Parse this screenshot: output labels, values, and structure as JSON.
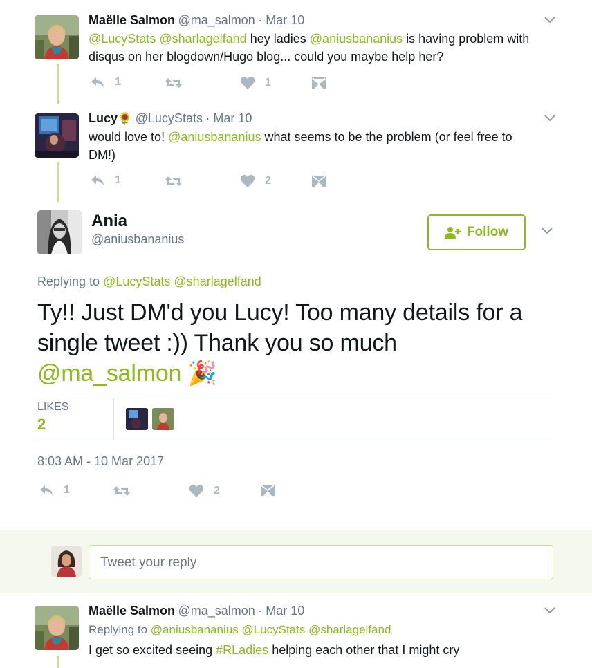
{
  "tweet1": {
    "name": "Maëlle Salmon",
    "handle": "@ma_salmon",
    "date": "· Mar 10",
    "mention1": "@LucyStats",
    "mention2": "@sharlagelfand",
    "text_a": "hey ladies",
    "mention3": "@aniusbananius",
    "text_b": "is having problem with",
    "text_c": "disqus on her blogdown/Hugo blog... could you maybe help her?",
    "reply_count": "1",
    "like_count": "1"
  },
  "tweet2": {
    "name": "Lucy",
    "name_emoji": "🌻",
    "handle": "@LucyStats",
    "date": "· Mar 10",
    "text_a": "would love to!",
    "mention1": "@aniusbananius",
    "text_b": "what seems to be the problem (or feel free to",
    "text_c": "DM!)",
    "reply_count": "1",
    "like_count": "2"
  },
  "main_tweet": {
    "name": "Ania",
    "handle": "@aniusbananius",
    "follow_label": "Follow",
    "replying_label": "Replying to",
    "reply_mention1": "@LucyStats",
    "reply_mention2": "@sharlagelfand",
    "text_line1": "Ty!! Just DM'd you Lucy! Too many details for a",
    "text_line2": "single tweet :)) Thank you so much",
    "text_mention": "@ma_salmon",
    "text_emoji": "🎉",
    "likes_label": "LIKES",
    "likes_count": "2",
    "timestamp": "8:03 AM - 10 Mar 2017",
    "reply_count": "1",
    "like_count": "2"
  },
  "reply_box": {
    "placeholder": "Tweet your reply"
  },
  "tweet3": {
    "name": "Maëlle Salmon",
    "handle": "@ma_salmon",
    "date": "· Mar 10",
    "replying_label": "Replying to",
    "mention1": "@aniusbananius",
    "mention2": "@LucyStats",
    "mention3": "@sharlagelfand",
    "text_a": "I get so excited seeing",
    "hashtag": "#RLadies",
    "text_b": "helping each other that I might cry"
  },
  "colors": {
    "accent": "#8bbb1c",
    "thread_line": "#c8df8e",
    "muted": "#657786",
    "icon": "#aab8c2"
  }
}
